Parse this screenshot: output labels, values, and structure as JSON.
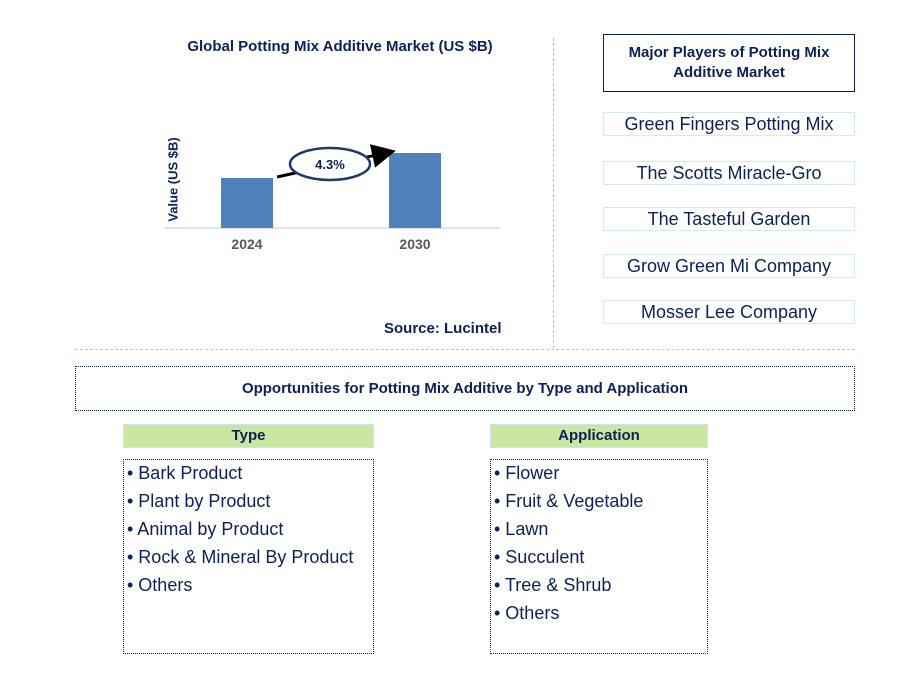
{
  "chart_data": {
    "type": "bar",
    "title": "Global Potting Mix Additive Market (US $B)",
    "ylabel": "Value (US $B)",
    "xlabel": "",
    "categories": [
      "2024",
      "2030"
    ],
    "values": [
      1.0,
      1.5
    ],
    "annotation": "4.3%",
    "grid": false,
    "bar_color": "#4f81bd",
    "source": "Source: Lucintel"
  },
  "players": {
    "title": "Major Players of Potting Mix Additive Market",
    "items": [
      "Green Fingers Potting Mix",
      "The Scotts Miracle-Gro",
      "The Tasteful Garden",
      "Grow Green Mi Company",
      "Mosser Lee Company"
    ]
  },
  "opportunities": {
    "title": "Opportunities for Potting Mix Additive by Type and Application",
    "type": {
      "label": "Type",
      "items": [
        "• Bark Product",
        "• Plant by Product",
        "• Animal by Product",
        "• Rock & Mineral By Product",
        "• Others"
      ]
    },
    "application": {
      "label": "Application",
      "items": [
        "• Flower",
        "• Fruit & Vegetable",
        "• Lawn",
        "• Succulent",
        "• Tree & Shrub",
        "• Others"
      ]
    }
  }
}
